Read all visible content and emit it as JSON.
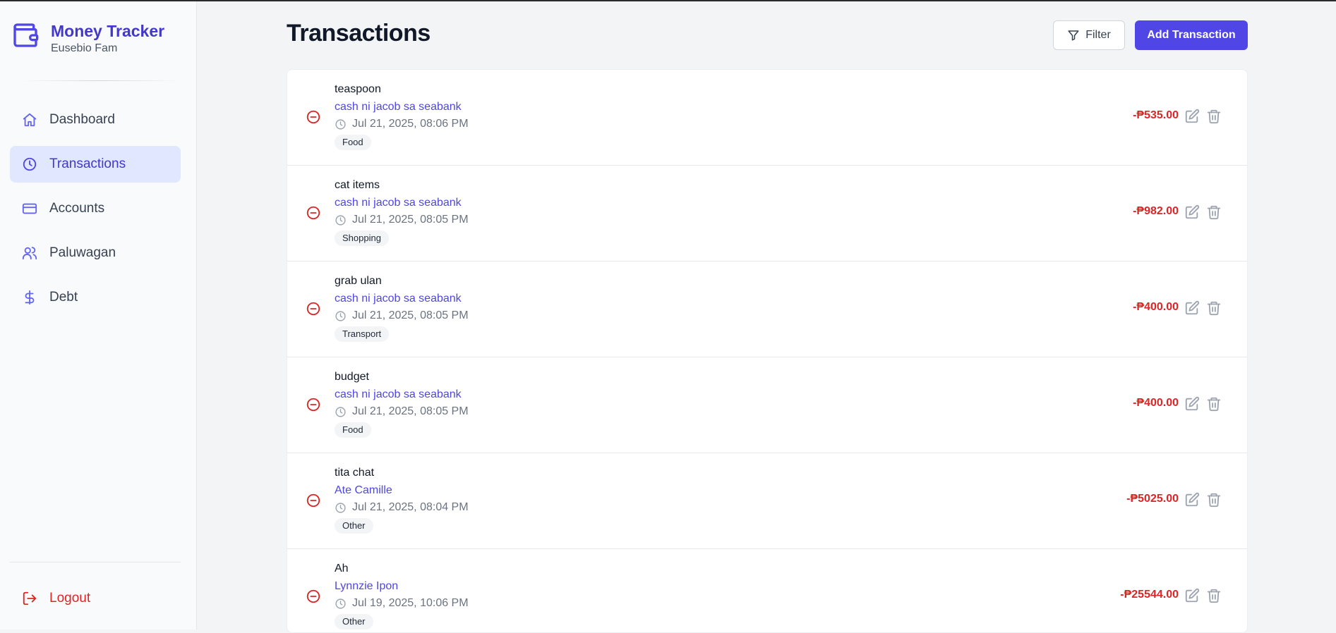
{
  "brand": {
    "title": "Money Tracker",
    "subtitle": "Eusebio Fam",
    "icon": "wallet-icon"
  },
  "nav": {
    "items": [
      {
        "label": "Dashboard",
        "icon": "home-icon",
        "active": false
      },
      {
        "label": "Transactions",
        "icon": "clock-icon",
        "active": true
      },
      {
        "label": "Accounts",
        "icon": "credit-card-icon",
        "active": false
      },
      {
        "label": "Paluwagan",
        "icon": "users-icon",
        "active": false
      },
      {
        "label": "Debt",
        "icon": "dollar-icon",
        "active": false
      }
    ],
    "logout_label": "Logout"
  },
  "header": {
    "title": "Transactions",
    "filter_label": "Filter",
    "add_label": "Add Transaction"
  },
  "colors": {
    "accent": "#4f46e5",
    "expense": "#dc2626"
  },
  "transactions": [
    {
      "title": "teaspoon",
      "account": "cash ni jacob sa seabank",
      "date": "Jul 21, 2025, 08:06 PM",
      "category": "Food",
      "amount": "-₱535.00",
      "type": "expense"
    },
    {
      "title": "cat items",
      "account": "cash ni jacob sa seabank",
      "date": "Jul 21, 2025, 08:05 PM",
      "category": "Shopping",
      "amount": "-₱982.00",
      "type": "expense"
    },
    {
      "title": "grab ulan",
      "account": "cash ni jacob sa seabank",
      "date": "Jul 21, 2025, 08:05 PM",
      "category": "Transport",
      "amount": "-₱400.00",
      "type": "expense"
    },
    {
      "title": "budget",
      "account": "cash ni jacob sa seabank",
      "date": "Jul 21, 2025, 08:05 PM",
      "category": "Food",
      "amount": "-₱400.00",
      "type": "expense"
    },
    {
      "title": "tita chat",
      "account": "Ate Camille",
      "date": "Jul 21, 2025, 08:04 PM",
      "category": "Other",
      "amount": "-₱5025.00",
      "type": "expense"
    },
    {
      "title": "Ah",
      "account": "Lynnzie Ipon",
      "date": "Jul 19, 2025, 10:06 PM",
      "category": "Other",
      "amount": "-₱25544.00",
      "type": "expense"
    }
  ]
}
